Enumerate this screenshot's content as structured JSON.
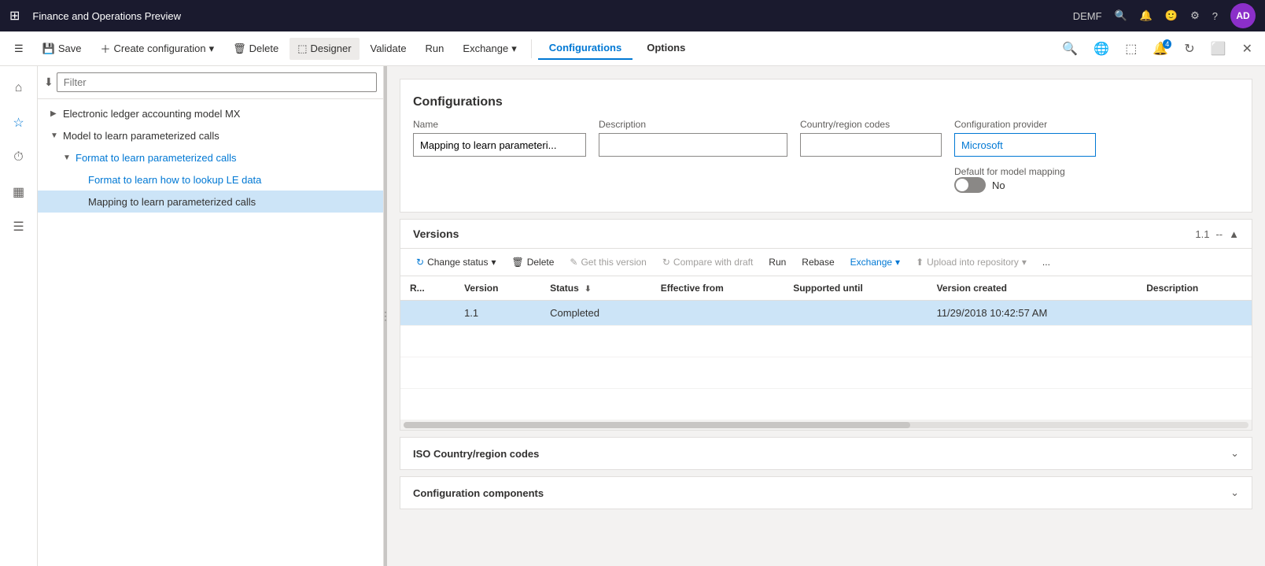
{
  "titleBar": {
    "gridIcon": "⊞",
    "title": "Finance and Operations Preview",
    "userCode": "DEMF",
    "avatar": "AD"
  },
  "commandBar": {
    "saveLabel": "Save",
    "createConfigLabel": "Create configuration",
    "deleteLabel": "Delete",
    "designerLabel": "Designer",
    "validateLabel": "Validate",
    "runLabel": "Run",
    "exchangeLabel": "Exchange",
    "tabs": [
      {
        "id": "configurations",
        "label": "Configurations",
        "active": true
      },
      {
        "id": "options",
        "label": "Options",
        "active": false
      }
    ]
  },
  "sidebar": {
    "icons": [
      {
        "name": "home-icon",
        "symbol": "⌂"
      },
      {
        "name": "favorites-icon",
        "symbol": "☆"
      },
      {
        "name": "recent-icon",
        "symbol": "🕐"
      },
      {
        "name": "workspaces-icon",
        "symbol": "▦"
      },
      {
        "name": "list-icon",
        "symbol": "☰"
      }
    ]
  },
  "tree": {
    "filterPlaceholder": "Filter",
    "items": [
      {
        "id": "electronic-ledger",
        "label": "Electronic ledger accounting model MX",
        "level": 1,
        "expanded": false,
        "selected": false
      },
      {
        "id": "model-learn",
        "label": "Model to learn parameterized calls",
        "level": 1,
        "expanded": true,
        "selected": false
      },
      {
        "id": "format-learn",
        "label": "Format to learn parameterized calls",
        "level": 2,
        "expanded": true,
        "selected": false
      },
      {
        "id": "format-lookup",
        "label": "Format to learn how to lookup LE data",
        "level": 3,
        "expanded": false,
        "selected": false
      },
      {
        "id": "mapping-learn",
        "label": "Mapping to learn parameterized calls",
        "level": 3,
        "expanded": false,
        "selected": true
      }
    ]
  },
  "configurationsForm": {
    "pageTitle": "Configurations",
    "fields": {
      "nameLabel": "Name",
      "nameValue": "Mapping to learn parameteri...",
      "descriptionLabel": "Description",
      "descriptionValue": "",
      "countryCodesLabel": "Country/region codes",
      "countryCodesValue": "",
      "configProviderLabel": "Configuration provider",
      "configProviderValue": "Microsoft",
      "defaultMappingLabel": "Default for model mapping",
      "defaultMappingValue": "No"
    }
  },
  "versionsSection": {
    "title": "Versions",
    "versionNumber": "1.1",
    "separator": "--",
    "toolbar": {
      "changeStatusLabel": "Change status",
      "deleteLabel": "Delete",
      "getThisVersionLabel": "Get this version",
      "compareWithDraftLabel": "Compare with draft",
      "runLabel": "Run",
      "rebaseLabel": "Rebase",
      "exchangeLabel": "Exchange",
      "uploadIntoRepositoryLabel": "Upload into repository",
      "moreLabel": "..."
    },
    "tableHeaders": [
      {
        "id": "resume",
        "label": "R..."
      },
      {
        "id": "version",
        "label": "Version"
      },
      {
        "id": "status",
        "label": "Status"
      },
      {
        "id": "effectiveFrom",
        "label": "Effective from"
      },
      {
        "id": "supportedUntil",
        "label": "Supported until"
      },
      {
        "id": "versionCreated",
        "label": "Version created"
      },
      {
        "id": "description",
        "label": "Description"
      }
    ],
    "rows": [
      {
        "resume": "",
        "version": "1.1",
        "status": "Completed",
        "effectiveFrom": "",
        "supportedUntil": "",
        "versionCreated": "11/29/2018 10:42:57 AM",
        "description": "",
        "selected": true
      }
    ]
  },
  "collapsibleSections": [
    {
      "id": "iso-codes",
      "label": "ISO Country/region codes"
    },
    {
      "id": "config-components",
      "label": "Configuration components"
    }
  ],
  "icons": {
    "expand": "▶",
    "collapse": "▼",
    "collapseUp": "▲",
    "chevronDown": "⌄",
    "chevronUp": "⌃",
    "filter": "⬇",
    "refresh": "↻",
    "trash": "🗑",
    "edit": "✎",
    "search": "🔍",
    "bell": "🔔",
    "gear": "⚙",
    "question": "?",
    "fullscreen": "⛶",
    "upload": "⬆",
    "more": "...",
    "dot3": "⋯"
  },
  "colors": {
    "accent": "#0078d4",
    "titleBg": "#1a1a2e",
    "selectedBg": "#cce4f7",
    "borderColor": "#e1dfdd",
    "textSecondary": "#605e5c",
    "providerColor": "#0078d4"
  }
}
